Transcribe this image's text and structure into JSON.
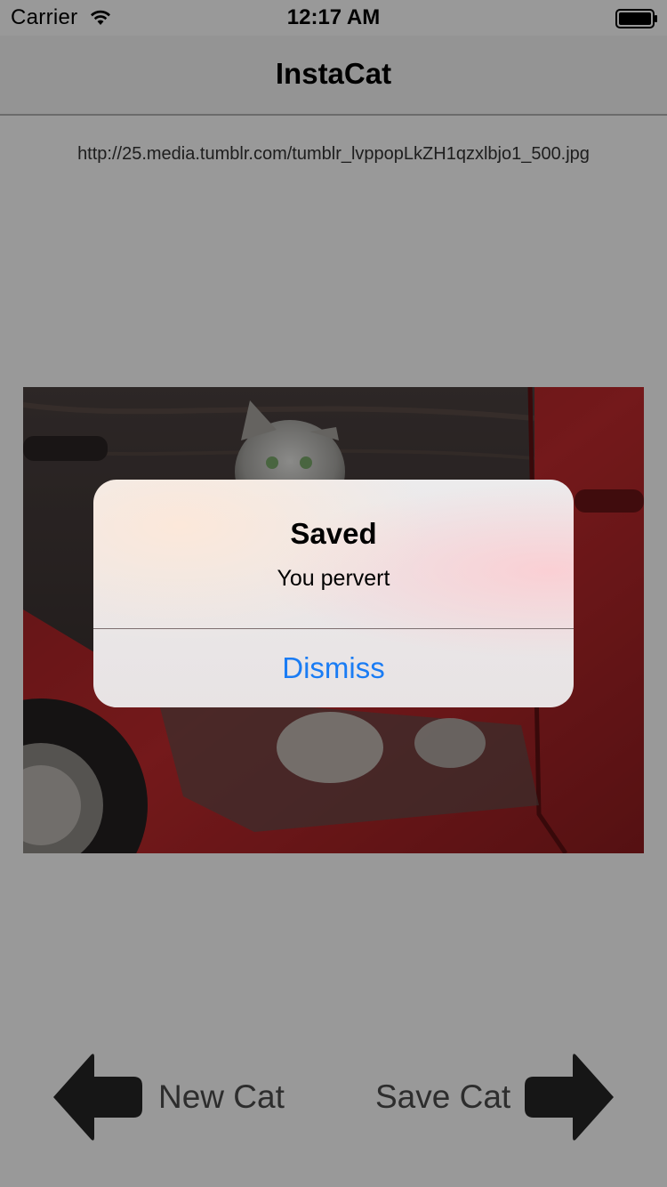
{
  "status_bar": {
    "carrier": "Carrier",
    "time": "12:17 AM",
    "wifi_icon": "wifi-icon",
    "battery_icon": "battery-full-icon"
  },
  "nav": {
    "title": "InstaCat"
  },
  "content": {
    "url": "http://25.media.tumblr.com/tumblr_lvppopLkZH1qzxlbjo1_500.jpg",
    "photo": "cat-painted-on-car-door"
  },
  "buttons": {
    "new_cat_label": "New Cat",
    "new_cat_icon": "arrow-left-icon",
    "save_cat_label": "Save Cat",
    "save_cat_icon": "arrow-right-icon"
  },
  "alert": {
    "title": "Saved",
    "message": "You pervert",
    "dismiss_label": "Dismiss"
  },
  "colors": {
    "accent": "#1a7cf4",
    "dim_overlay": "rgba(0,0,0,0.40)",
    "button_text": "#4c4c4c",
    "arrow": "#262626"
  }
}
